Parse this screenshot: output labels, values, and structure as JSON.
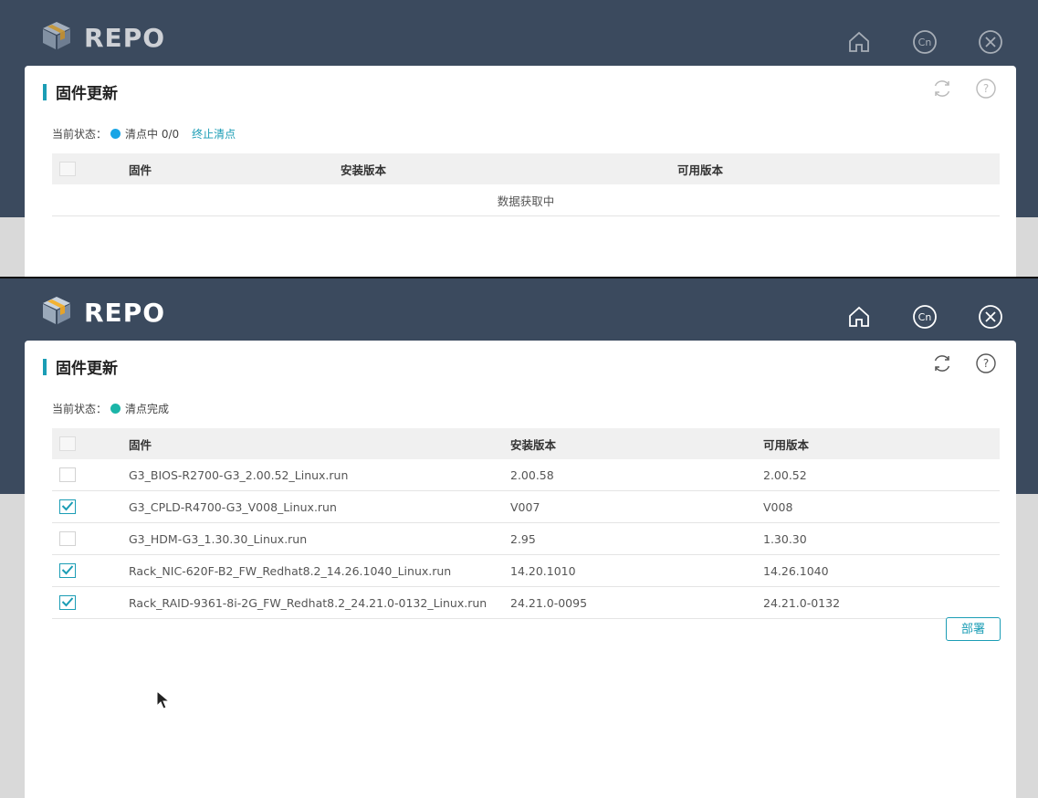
{
  "brand": {
    "name": "REPO"
  },
  "header_icons": [
    "home-icon",
    "language-cn-icon",
    "close-icon"
  ],
  "panel": {
    "title": "固件更新"
  },
  "table_headers": {
    "firmware": "固件",
    "installed": "安装版本",
    "available": "可用版本"
  },
  "shot1": {
    "status_label": "当前状态：",
    "status_text": "清点中 0/0",
    "status_color": "#19a5e6",
    "stop_link": "终止清点",
    "loading_text": "数据获取中"
  },
  "shot2": {
    "status_label": "当前状态：",
    "status_text": "清点完成",
    "status_color": "#1bb5a8",
    "rows": [
      {
        "checked": false,
        "firmware": "G3_BIOS-R2700-G3_2.00.52_Linux.run",
        "installed": "2.00.58",
        "available": "2.00.52"
      },
      {
        "checked": true,
        "firmware": "G3_CPLD-R4700-G3_V008_Linux.run",
        "installed": "V007",
        "available": "V008"
      },
      {
        "checked": false,
        "firmware": "G3_HDM-G3_1.30.30_Linux.run",
        "installed": "2.95",
        "available": "1.30.30"
      },
      {
        "checked": true,
        "firmware": "Rack_NIC-620F-B2_FW_Redhat8.2_14.26.1040_Linux.run",
        "installed": "14.20.1010",
        "available": "14.26.1040"
      },
      {
        "checked": true,
        "firmware": "Rack_RAID-9361-8i-2G_FW_Redhat8.2_24.21.0-0132_Linux.run",
        "installed": "24.21.0-0095",
        "available": "24.21.0-0132"
      }
    ],
    "deploy_button": "部署"
  },
  "colors": {
    "header_bg": "#3b4a5e",
    "accent": "#1b9db5"
  }
}
